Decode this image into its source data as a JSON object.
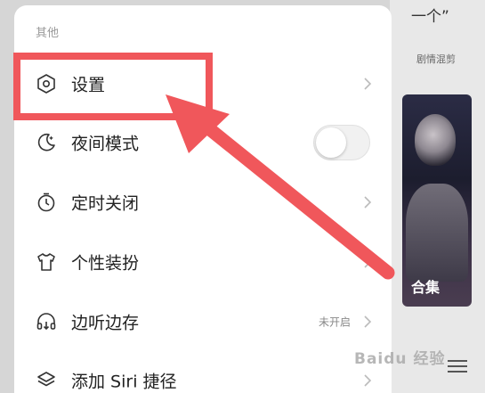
{
  "background": {
    "quote_text": "一个”",
    "caption": "剧情混剪",
    "photo_label": "合集",
    "watermark": "Baidu 经验"
  },
  "drawer": {
    "section_title": "其他",
    "items": [
      {
        "label": "设置",
        "icon": "hexagon-settings-icon"
      },
      {
        "label": "夜间模式",
        "icon": "moon-icon",
        "toggle": "off"
      },
      {
        "label": "定时关闭",
        "icon": "timer-icon"
      },
      {
        "label": "个性装扮",
        "icon": "tshirt-icon"
      },
      {
        "label": "边听边存",
        "icon": "headphones-download-icon",
        "status": "未开启"
      },
      {
        "label": "添加 Siri 捷径",
        "icon": "layers-icon"
      }
    ]
  },
  "annotation": {
    "color": "#f0575b",
    "target": "设置"
  }
}
